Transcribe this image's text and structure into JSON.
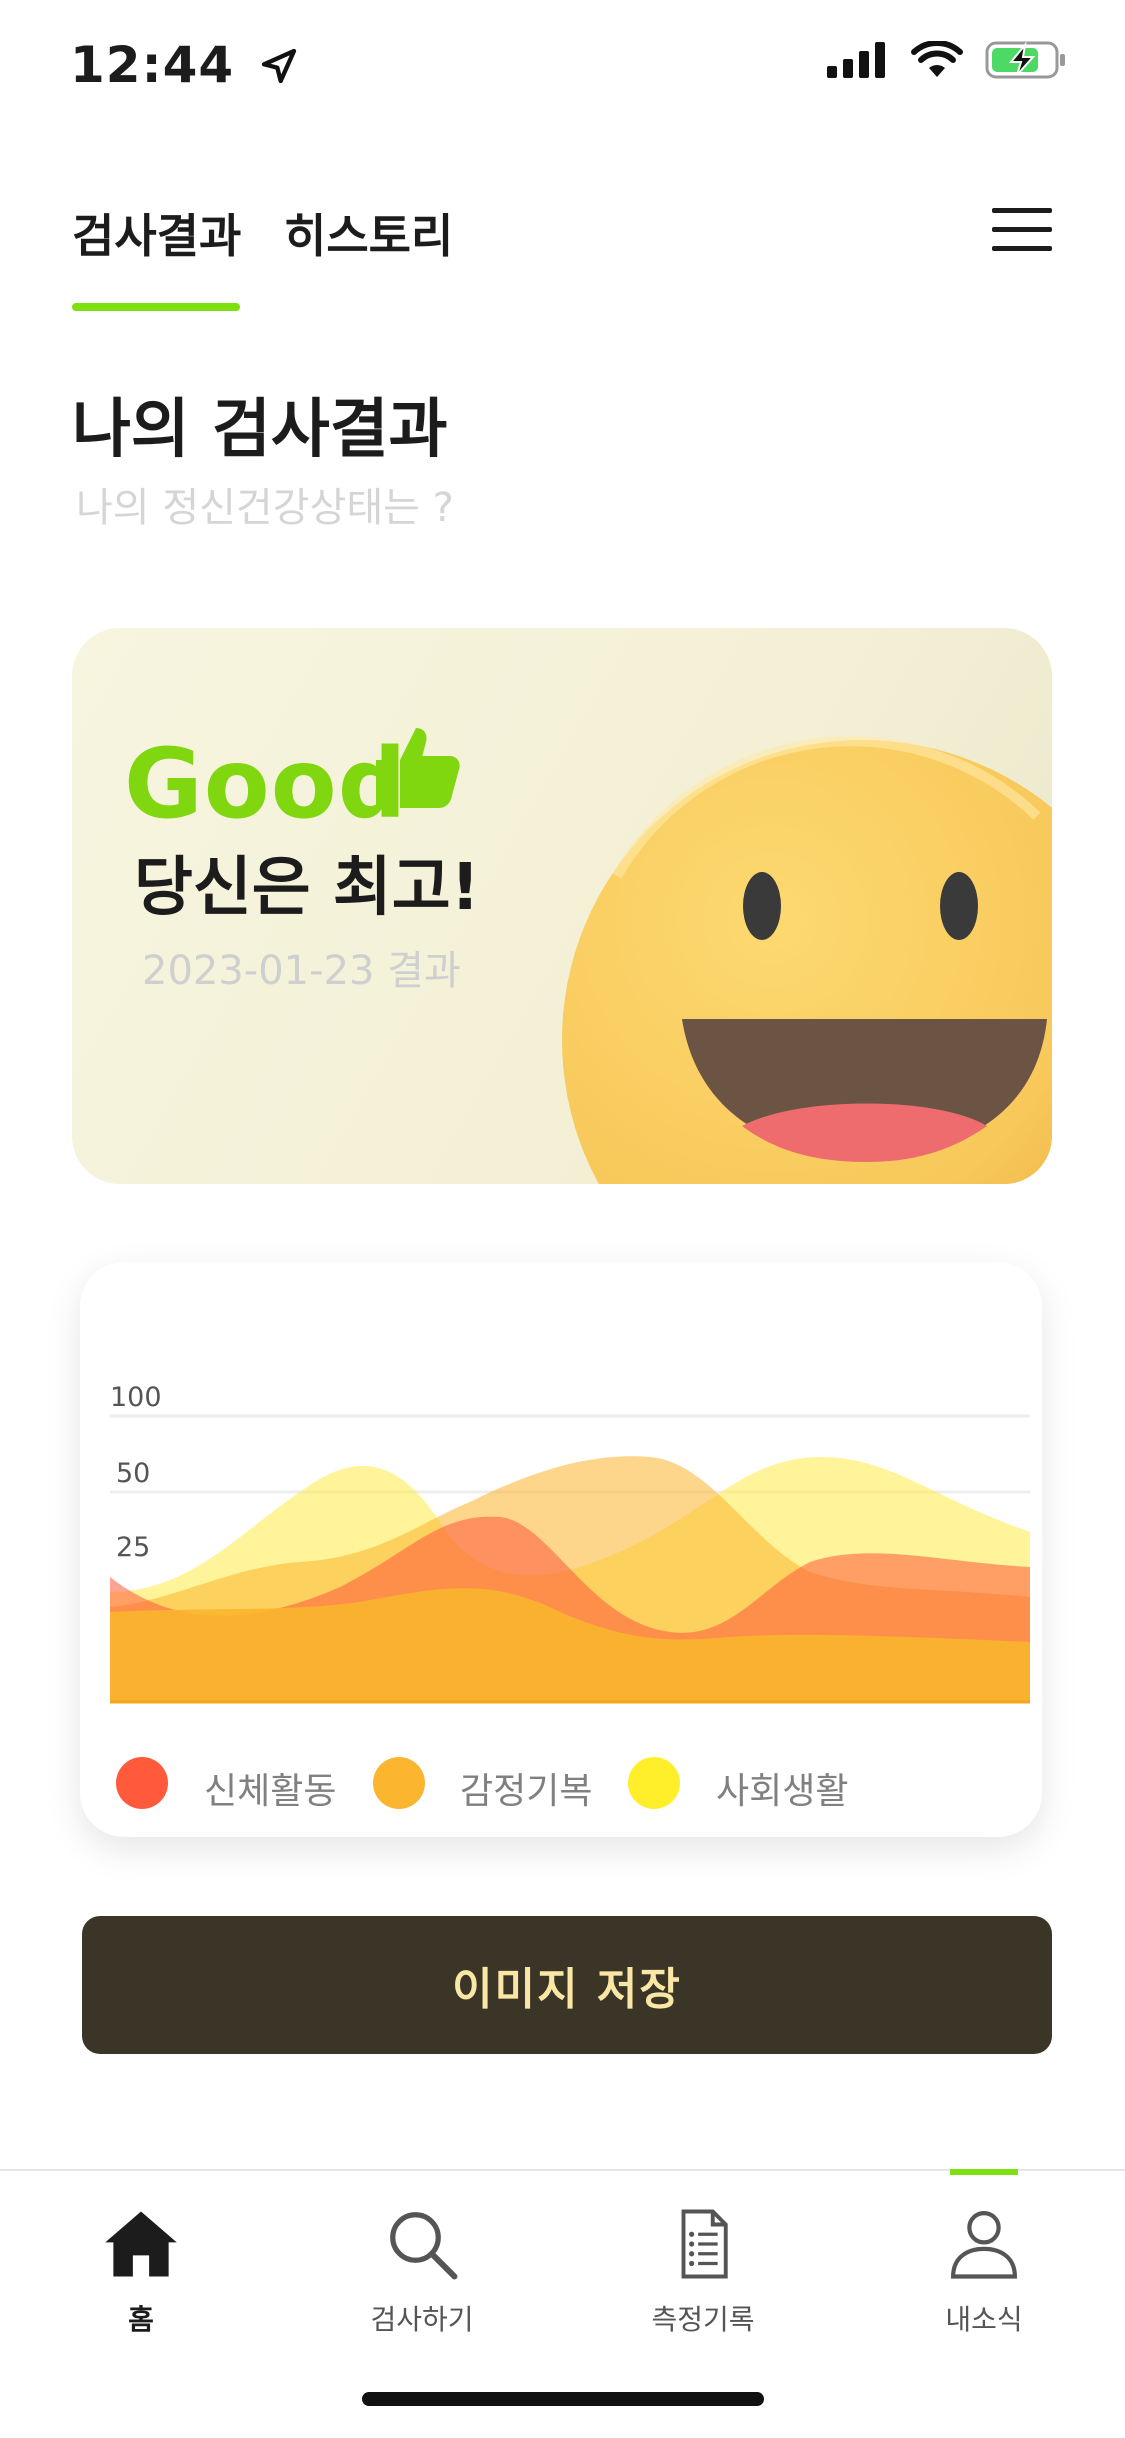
{
  "status": {
    "time": "12:44"
  },
  "tabs": [
    {
      "label": "검사결과",
      "active": true
    },
    {
      "label": "히스토리",
      "active": false
    }
  ],
  "header": {
    "title": "나의 검사결과",
    "subtitle": "나의 정신건강상태는 ?"
  },
  "result_card": {
    "headline": "Good",
    "message": "당신은 최고!",
    "date": "2023-01-23 결과"
  },
  "chart_data": {
    "type": "area",
    "y_ticks": [
      "100",
      "50",
      "25"
    ],
    "series": [
      {
        "name": "신체활동",
        "color": "#ff5a3c"
      },
      {
        "name": "감정기복",
        "color": "#fbb52e"
      },
      {
        "name": "사회생활",
        "color": "#ffea33"
      }
    ],
    "grid": true,
    "legend": "bottom"
  },
  "save_button": {
    "label": "이미지 저장"
  },
  "nav": [
    {
      "label": "홈",
      "icon": "home-icon",
      "active": true
    },
    {
      "label": "검사하기",
      "icon": "search-icon",
      "active": false
    },
    {
      "label": "측정기록",
      "icon": "document-icon",
      "active": false
    },
    {
      "label": "내소식",
      "icon": "person-icon",
      "active": false
    }
  ],
  "colors": {
    "accent": "#7ee00f",
    "button_bg": "#3a3527",
    "button_text": "#fbe7a5"
  }
}
